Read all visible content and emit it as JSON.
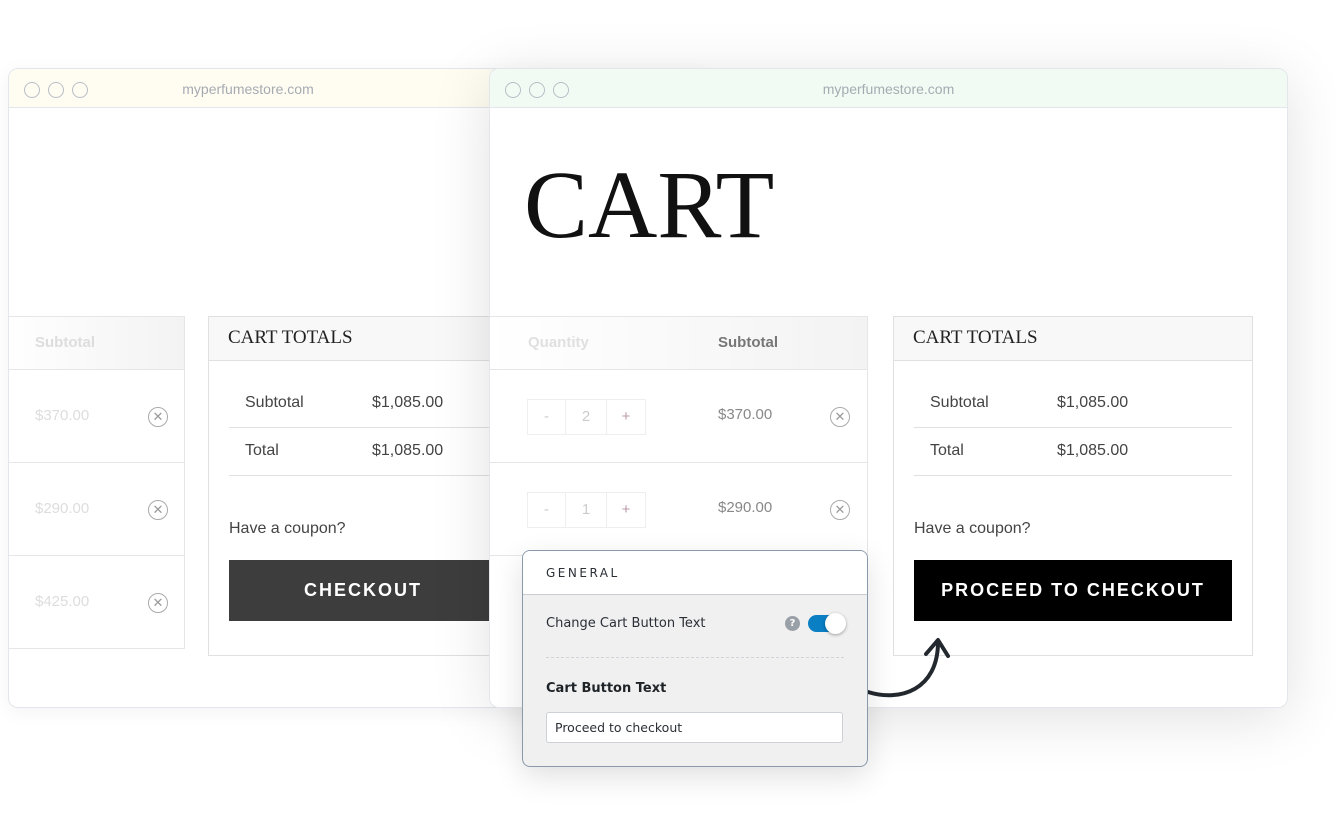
{
  "browser": {
    "url": "myperfumestore.com"
  },
  "back_window": {
    "subtotal_header": "Subtotal",
    "rows": [
      {
        "subtotal": "$370.00"
      },
      {
        "subtotal": "$290.00"
      },
      {
        "subtotal": "$425.00"
      }
    ],
    "totals": {
      "title": "CART TOTALS",
      "subtotal_label": "Subtotal",
      "subtotal_value": "$1,085.00",
      "total_label": "Total",
      "total_value": "$1,085.00",
      "coupon": "Have a coupon?",
      "button": "CHECKOUT",
      "button_color": "#3d3d3d"
    }
  },
  "front_window": {
    "title": "CART",
    "headers": {
      "quantity": "Quantity",
      "subtotal": "Subtotal"
    },
    "rows": [
      {
        "qty": "2",
        "subtotal": "$370.00"
      },
      {
        "qty": "1",
        "subtotal": "$290.00"
      }
    ],
    "totals": {
      "title": "CART TOTALS",
      "subtotal_label": "Subtotal",
      "subtotal_value": "$1,085.00",
      "total_label": "Total",
      "total_value": "$1,085.00",
      "coupon": "Have a coupon?",
      "button": "PROCEED TO CHECKOUT",
      "button_color": "#000000"
    }
  },
  "settings_panel": {
    "section": "GENERAL",
    "toggle_label": "Change Cart Button Text",
    "toggle_on": true,
    "toggle_color": "#0a7fc4",
    "field_label": "Cart Button Text",
    "field_value": "Proceed to checkout"
  }
}
